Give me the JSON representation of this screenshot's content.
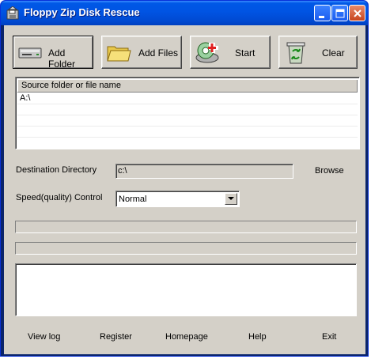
{
  "window": {
    "title": "Floppy Zip Disk Rescue"
  },
  "toolbar": {
    "add_folder": "Add Folder",
    "add_files": "Add Files",
    "start": "Start",
    "clear": "Clear"
  },
  "list": {
    "header": "Source folder or file name",
    "rows": [
      "A:\\"
    ]
  },
  "destination": {
    "label": "Destination Directory",
    "value": "c:\\",
    "browse": "Browse"
  },
  "speed": {
    "label": "Speed(quality) Control",
    "selected": "Normal"
  },
  "footer": {
    "view_log": "View log",
    "register": "Register",
    "homepage": "Homepage",
    "help": "Help",
    "exit": "Exit"
  },
  "colors": {
    "titlebar": "#0054e3",
    "face": "#d4d0c8",
    "close": "#c8451e"
  }
}
